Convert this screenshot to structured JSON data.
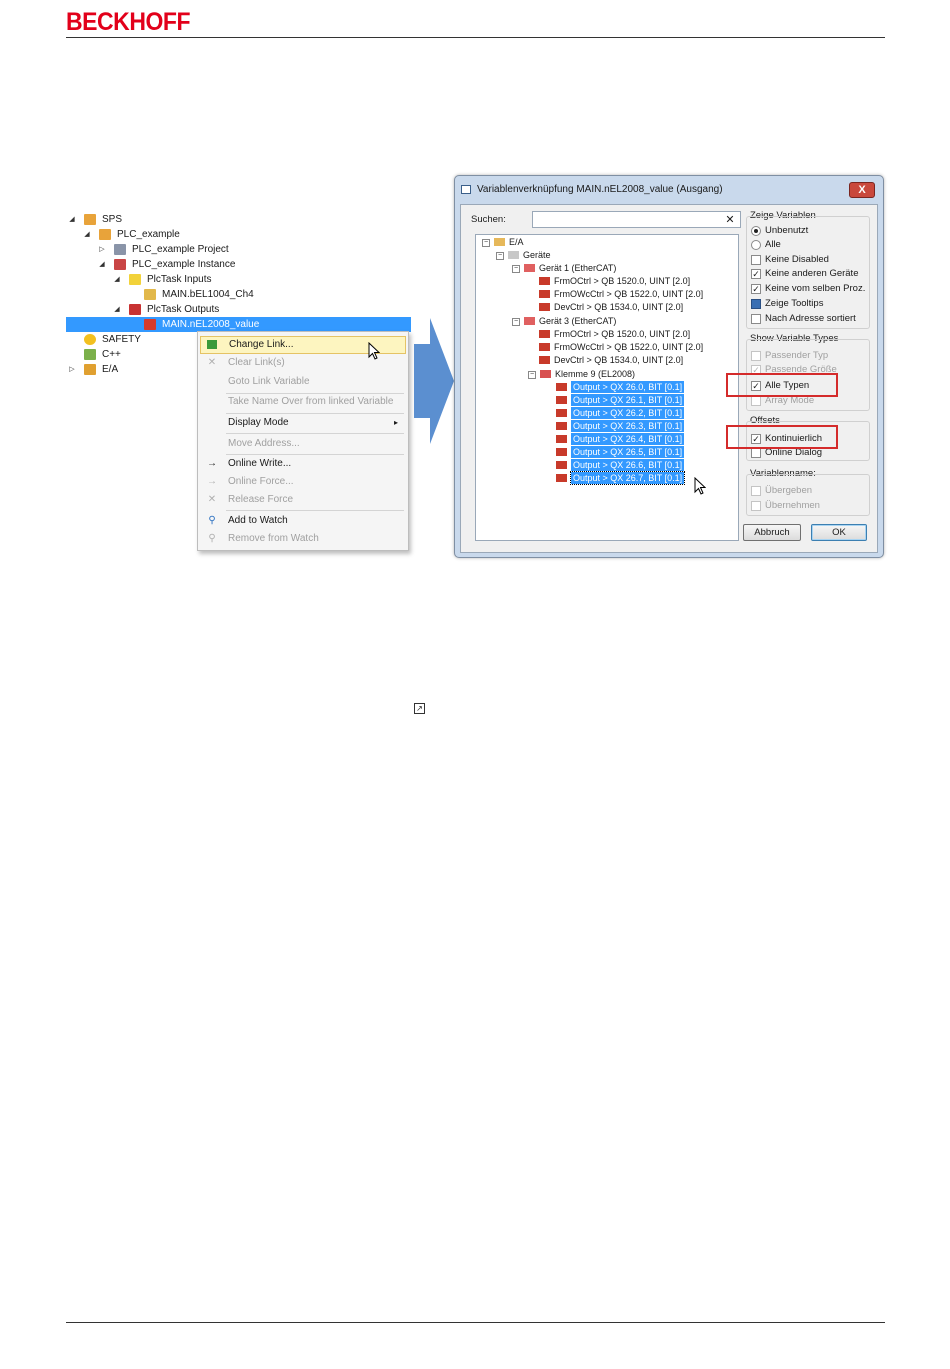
{
  "brand": "BECKHOFF",
  "tree": {
    "items": [
      {
        "label": "SPS",
        "expander": "◢",
        "icon": "plc-icon"
      },
      {
        "label": "PLC_example",
        "expander": "◢",
        "icon": "plc-project-icon"
      },
      {
        "label": "PLC_example Project",
        "expander": "▷",
        "icon": "project-icon"
      },
      {
        "label": "PLC_example Instance",
        "expander": "◢",
        "icon": "instance-icon"
      },
      {
        "label": "PlcTask Inputs",
        "expander": "◢",
        "icon": "inputs-folder-icon"
      },
      {
        "label": "MAIN.bEL1004_Ch4",
        "expander": "",
        "icon": "input-variable-icon"
      },
      {
        "label": "PlcTask Outputs",
        "expander": "◢",
        "icon": "outputs-folder-icon"
      },
      {
        "label": "MAIN.nEL2008_value",
        "expander": "",
        "icon": "output-variable-icon"
      },
      {
        "label": "SAFETY",
        "expander": "",
        "icon": "safety-icon"
      },
      {
        "label": "C++",
        "expander": "",
        "icon": "cpp-icon"
      },
      {
        "label": "E/A",
        "expander": "▷",
        "icon": "io-icon"
      }
    ]
  },
  "context_menu": {
    "items": [
      {
        "label": "Change Link...",
        "state": "highlighted",
        "icon": "change-link-icon"
      },
      {
        "label": "Clear Link(s)",
        "state": "disabled",
        "icon": "clear-link-icon"
      },
      {
        "label": "Goto Link Variable",
        "state": "disabled",
        "icon": ""
      },
      {
        "label": "Take Name Over from linked Variable",
        "state": "disabled",
        "icon": ""
      },
      {
        "label": "Display Mode",
        "state": "normal",
        "icon": "",
        "submenu": "▸"
      },
      {
        "label": "Move Address...",
        "state": "disabled",
        "icon": ""
      },
      {
        "label": "Online Write...",
        "state": "normal",
        "icon": "online-write-icon"
      },
      {
        "label": "Online Force...",
        "state": "disabled",
        "icon": "online-force-icon"
      },
      {
        "label": "Release Force",
        "state": "disabled",
        "icon": "release-force-icon"
      },
      {
        "label": "Add to Watch",
        "state": "normal",
        "icon": "add-watch-icon"
      },
      {
        "label": "Remove from Watch",
        "state": "disabled",
        "icon": "remove-watch-icon"
      }
    ]
  },
  "dialog": {
    "title": "Variablenverknüpfung MAIN.nEL2008_value (Ausgang)",
    "close": "X",
    "search_label": "Suchen:",
    "search_value": "",
    "search_clear": "✕",
    "tree": [
      {
        "label": "E/A",
        "type": "root"
      },
      {
        "label": "Geräte",
        "type": "folder"
      },
      {
        "label": "Gerät 1 (EtherCAT)",
        "type": "device"
      },
      {
        "label": "FrmOCtrl    >    QB 1520.0, UINT [2.0]",
        "type": "var"
      },
      {
        "label": "FrmOWcCtrl    >    QB 1522.0, UINT [2.0]",
        "type": "var"
      },
      {
        "label": "DevCtrl    >    QB 1534.0, UINT [2.0]",
        "type": "var"
      },
      {
        "label": "Gerät 3 (EtherCAT)",
        "type": "device"
      },
      {
        "label": "FrmOCtrl    >    QB 1520.0, UINT [2.0]",
        "type": "var"
      },
      {
        "label": "FrmOWcCtrl    >    QB 1522.0, UINT [2.0]",
        "type": "var"
      },
      {
        "label": "DevCtrl    >    QB 1534.0, UINT [2.0]",
        "type": "var"
      },
      {
        "label": "Klemme 9 (EL2008)",
        "type": "terminal"
      },
      {
        "label": "Output    >    QX 26.0, BIT [0.1]",
        "type": "output"
      },
      {
        "label": "Output    >    QX 26.1, BIT [0.1]",
        "type": "output"
      },
      {
        "label": "Output    >    QX 26.2, BIT [0.1]",
        "type": "output"
      },
      {
        "label": "Output    >    QX 26.3, BIT [0.1]",
        "type": "output"
      },
      {
        "label": "Output    >    QX 26.4, BIT [0.1]",
        "type": "output"
      },
      {
        "label": "Output    >    QX 26.5, BIT [0.1]",
        "type": "output"
      },
      {
        "label": "Output    >    QX 26.6, BIT [0.1]",
        "type": "output"
      },
      {
        "label": "Output    >    QX 26.7, BIT [0.1]",
        "type": "output"
      }
    ],
    "show_variables": {
      "title": "Zeige Variablen",
      "options": [
        {
          "label": "Unbenutzt",
          "kind": "radio",
          "checked": true
        },
        {
          "label": "Alle",
          "kind": "radio",
          "checked": false
        },
        {
          "label": "Keine Disabled",
          "kind": "check",
          "checked": false
        },
        {
          "label": "Keine anderen Geräte",
          "kind": "check",
          "checked": true
        },
        {
          "label": "Keine vom selben Proz.",
          "kind": "check",
          "checked": true
        },
        {
          "label": "Zeige Tooltips",
          "kind": "check",
          "checked": "filled"
        },
        {
          "label": "Nach Adresse sortiert",
          "kind": "check",
          "checked": false
        }
      ]
    },
    "show_variable_types": {
      "title": "Show Variable Types",
      "options": [
        {
          "label": "Passender Typ",
          "checked": false,
          "disabled": true
        },
        {
          "label": "Passende Größe",
          "checked": true,
          "disabled": true
        },
        {
          "label": "Alle Typen",
          "checked": true,
          "disabled": false
        },
        {
          "label": "Array Mode",
          "checked": false,
          "disabled": true
        }
      ]
    },
    "offsets": {
      "title": "Offsets",
      "options": [
        {
          "label": "Kontinuierlich",
          "checked": true,
          "disabled": false
        },
        {
          "label": "Online Dialog",
          "checked": false,
          "disabled": false
        }
      ]
    },
    "variable_name": {
      "title": "Variablenname:",
      "options": [
        {
          "label": "Übergeben",
          "checked": false,
          "disabled": true
        },
        {
          "label": "Übernehmen",
          "checked": false,
          "disabled": true
        }
      ]
    },
    "cancel_label": "Abbruch",
    "ok_label": "OK"
  },
  "colors": {
    "brand_red": "#e2001a",
    "selection_blue": "#3399ff",
    "menu_highlight": "#fdf5c0",
    "annotation_red": "#d42b2b",
    "arrow_blue": "#5b8fd0"
  }
}
